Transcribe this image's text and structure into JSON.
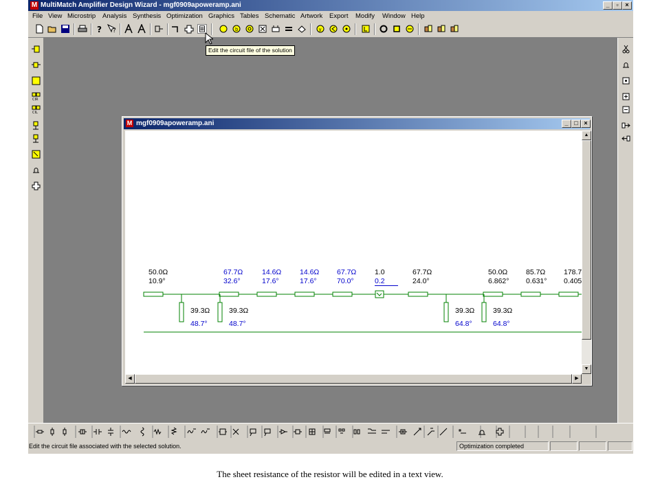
{
  "app": {
    "title": "MultiMatch Amplifier Design Wizard - mgf0909apoweramp.ani",
    "logo_letter": "M"
  },
  "menu": [
    "File",
    "View",
    "Microstrip",
    "Analysis",
    "Synthesis",
    "Optimization",
    "Graphics",
    "Tables",
    "Schematic",
    "Artwork",
    "Export",
    "Modify",
    "Window",
    "Help"
  ],
  "tooltip": "Edit the circuit file of the solution",
  "child_window": {
    "title": "mgf0909apoweramp.ani"
  },
  "schematic": {
    "series": [
      {
        "top": "50.0Ω",
        "bottom": "10.9°",
        "blue": false
      },
      {
        "top": "67.7Ω",
        "bottom": "32.6°",
        "blue": true
      },
      {
        "top": "14.6Ω",
        "bottom": "17.6°",
        "blue": true
      },
      {
        "top": "14.6Ω",
        "bottom": "17.6°",
        "blue": true
      },
      {
        "top": "67.7Ω",
        "bottom": "70.0°",
        "blue": true
      },
      {
        "top": "1.0",
        "bottom": "0.2",
        "blue": false
      },
      {
        "top": "67.7Ω",
        "bottom": "24.0°",
        "blue": false
      },
      {
        "top": "50.0Ω",
        "bottom": "6.862°",
        "blue": false
      },
      {
        "top": "85.7Ω",
        "bottom": "0.631°",
        "blue": false
      },
      {
        "top": "178.7",
        "bottom": "0.405",
        "blue": false
      }
    ],
    "stubs": [
      {
        "top": "39.3Ω",
        "bottom": "48.7°"
      },
      {
        "top": "39.3Ω",
        "bottom": "48.7°"
      },
      {
        "top": "39.3Ω",
        "bottom": "64.8°"
      },
      {
        "top": "39.3Ω",
        "bottom": "64.8°"
      }
    ]
  },
  "status": {
    "message": "Edit the circuit file associated with the selected solution.",
    "state": "Optimization completed"
  },
  "caption": "The sheet resistance of the resistor will be edited in a text view.",
  "colors": {
    "circuit": "#008000",
    "blue_value": "#0000cc",
    "titlebar": "#0a246a"
  }
}
